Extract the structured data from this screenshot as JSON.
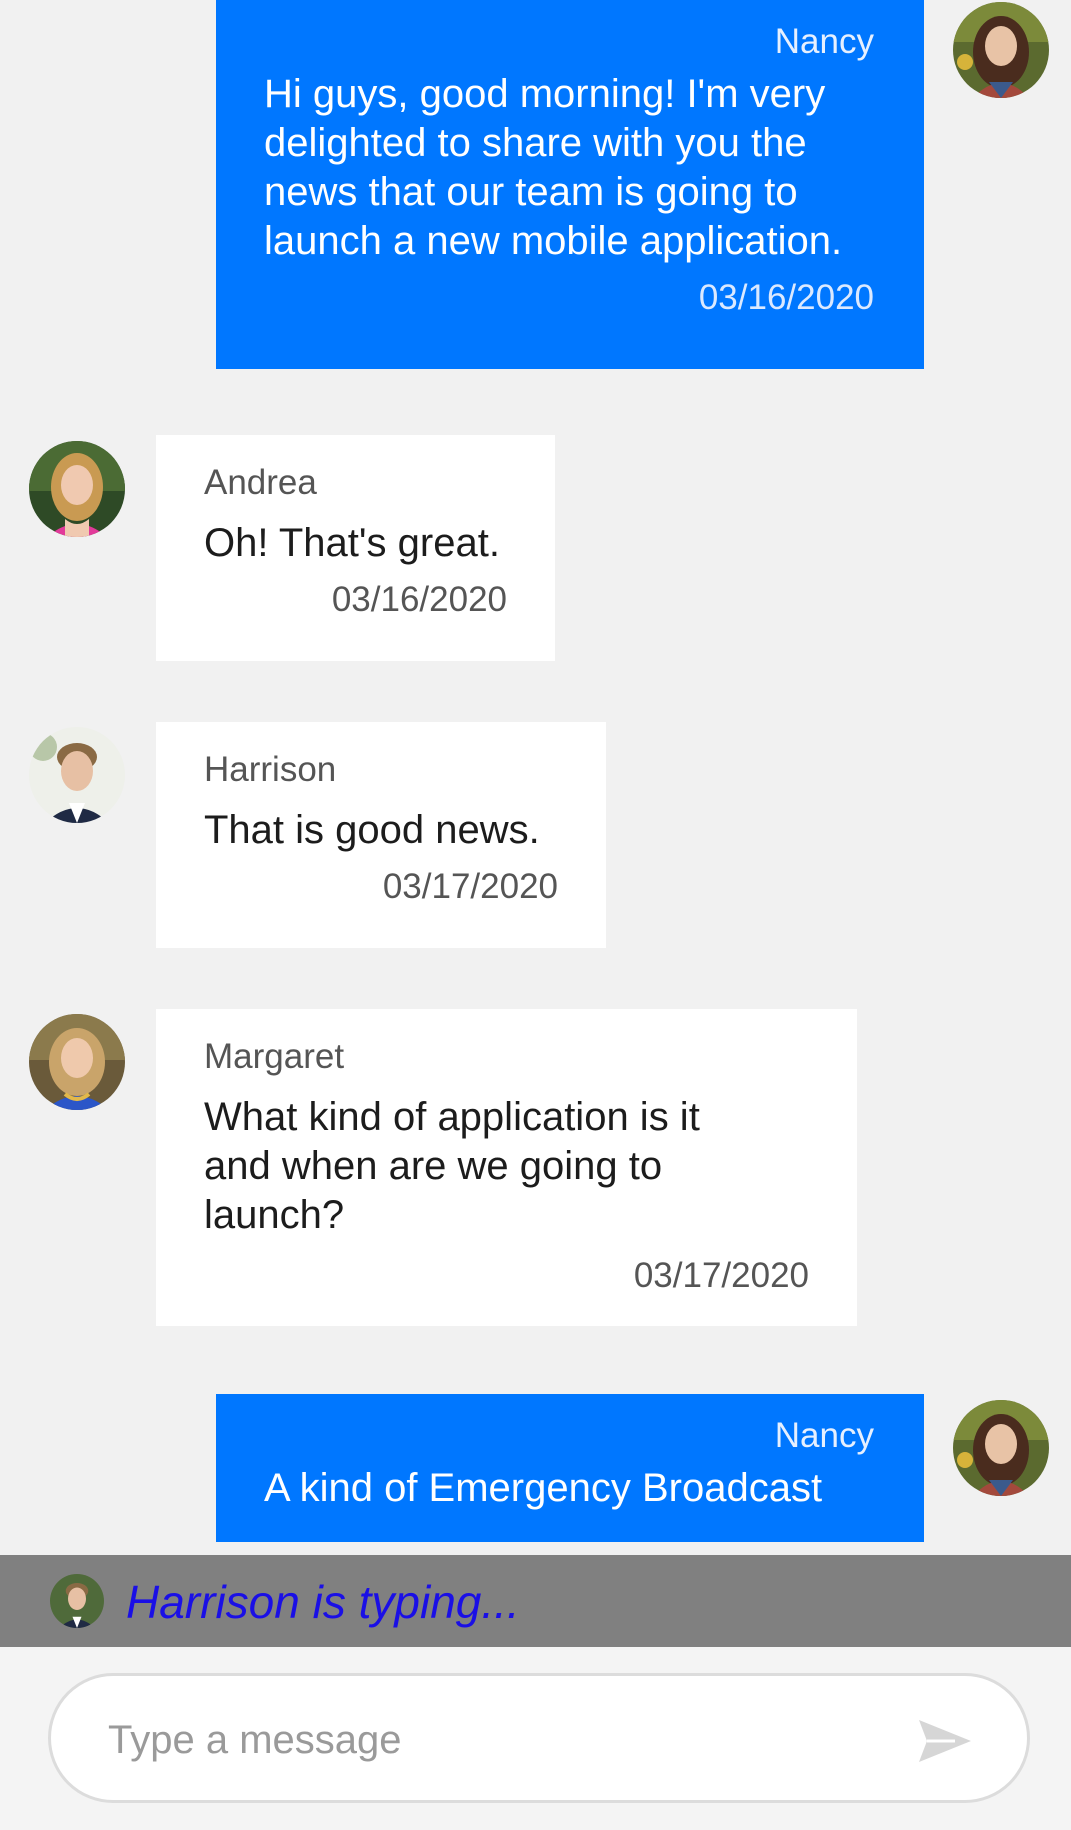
{
  "messages": [
    {
      "sender": "Nancy",
      "text": "Hi guys, good morning! I'm very delighted to share with you the news that our team is going to launch a new mobile application.",
      "date": "03/16/2020",
      "direction": "outgoing"
    },
    {
      "sender": "Andrea",
      "text": "Oh! That's great.",
      "date": "03/16/2020",
      "direction": "incoming"
    },
    {
      "sender": "Harrison",
      "text": "That is good news.",
      "date": "03/17/2020",
      "direction": "incoming"
    },
    {
      "sender": "Margaret",
      "text": "What kind of application is it and when are we going to launch?",
      "date": "03/17/2020",
      "direction": "incoming"
    },
    {
      "sender": "Nancy",
      "text": "A kind of Emergency Broadcast",
      "direction": "outgoing"
    }
  ],
  "typing_indicator": {
    "text": "Harrison is typing..."
  },
  "composer": {
    "placeholder": "Type a message",
    "value": ""
  },
  "colors": {
    "outgoing_bubble": "#0077ff",
    "incoming_bubble": "#ffffff",
    "typing_bar": "#808080",
    "typing_text": "#1a0fe6"
  },
  "icons": {
    "send": "send-icon"
  }
}
